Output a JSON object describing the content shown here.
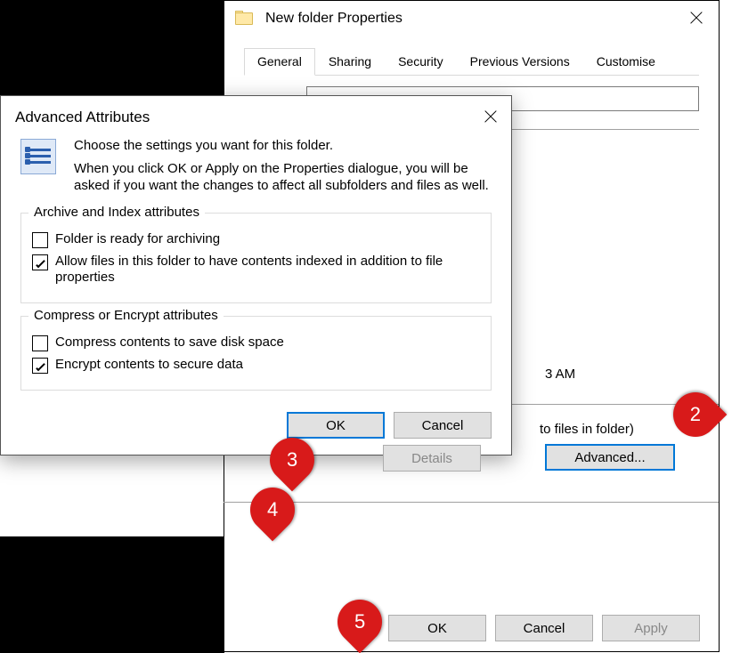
{
  "properties": {
    "title": "New folder Properties",
    "tabs": [
      "General",
      "Sharing",
      "Security",
      "Previous Versions",
      "Customise"
    ],
    "time_fragment": "3 AM",
    "apply_note_fragment": "to files in folder)",
    "advanced_button": "Advanced...",
    "buttons": {
      "ok": "OK",
      "cancel": "Cancel",
      "apply": "Apply"
    }
  },
  "advanced": {
    "title": "Advanced Attributes",
    "intro1": "Choose the settings you want for this folder.",
    "intro2": "When you click OK or Apply on the Properties dialogue, you will be asked if you want the changes to affect all subfolders and files as well.",
    "archive_legend": "Archive and Index attributes",
    "archive_chk1": "Folder is ready for archiving",
    "archive_chk2": "Allow files in this folder to have contents indexed in addition to file properties",
    "compress_legend": "Compress or Encrypt attributes",
    "compress_chk1": "Compress contents to save disk space",
    "compress_chk2": "Encrypt contents to secure data",
    "details": "Details",
    "ok": "OK",
    "cancel": "Cancel"
  },
  "callouts": {
    "c2": "2",
    "c3": "3",
    "c4": "4",
    "c5": "5"
  }
}
